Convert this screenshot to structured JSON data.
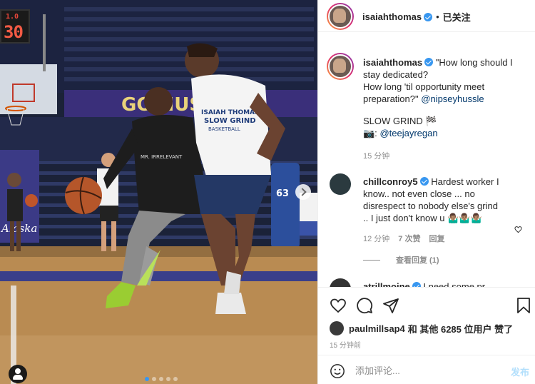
{
  "photo": {
    "scoreboard_small": "1.0",
    "scoreboard_big": "30",
    "banner_text": "GO HUS",
    "shirt_left": "MR. IRRELEVANT",
    "shirt_right_line1": "ISAIAH THOMAS",
    "shirt_right_line2": "SLOW GRIND",
    "shirt_right_line3": "BASKETBALL",
    "pad_text": "Alaska",
    "pad_number": "63",
    "carousel_dots": 5,
    "carousel_active": 0
  },
  "header": {
    "username": "isaiahthomas",
    "separator": "•",
    "follow_status": "已关注"
  },
  "caption": {
    "username": "isaiahthomas",
    "text_line1": "\"How long should I",
    "text_line2": "stay dedicated?",
    "text_line3": "How long 'til opportunity meet",
    "text_line4": "preparation?\"",
    "mention1": "@nipseyhussle",
    "text_line5": "SLOW GRIND 🏁",
    "camera_prefix": "📷:",
    "mention2": "@teejayregan",
    "time": "15 分钟"
  },
  "comment1": {
    "username": "chillconroy5",
    "text_line1": "Hardest worker I",
    "text_line2": "know.. not even close ... no",
    "text_line3": "disrespect to nobody else's grind",
    "text_line4": ".. I just don't know u 🤷🏽‍♂️🤷🏽‍♂️🤷🏽‍♂️",
    "time": "12 分钟",
    "likes": "7 次赞",
    "reply": "回复",
    "view_replies": "查看回复 (1)"
  },
  "comment2": {
    "username": "atrillmoine",
    "text": "I need some pr"
  },
  "likes": {
    "liker": "paulmillsap4",
    "text": "和 其他 6285 位用户 赞了"
  },
  "posted_time": "15 分钟前",
  "add_comment": {
    "placeholder": "添加评论...",
    "post_label": "发布"
  },
  "colors": {
    "link": "#00376b",
    "verified": "#3897f0",
    "post_disabled": "#b2dffc",
    "meta": "#8e8e8e"
  },
  "icons": {
    "like": "heart-icon",
    "comment": "comment-icon",
    "share": "share-icon",
    "save": "bookmark-icon",
    "emoji": "smile-icon",
    "tag": "user-tag-icon",
    "next": "chevron-right-icon"
  }
}
